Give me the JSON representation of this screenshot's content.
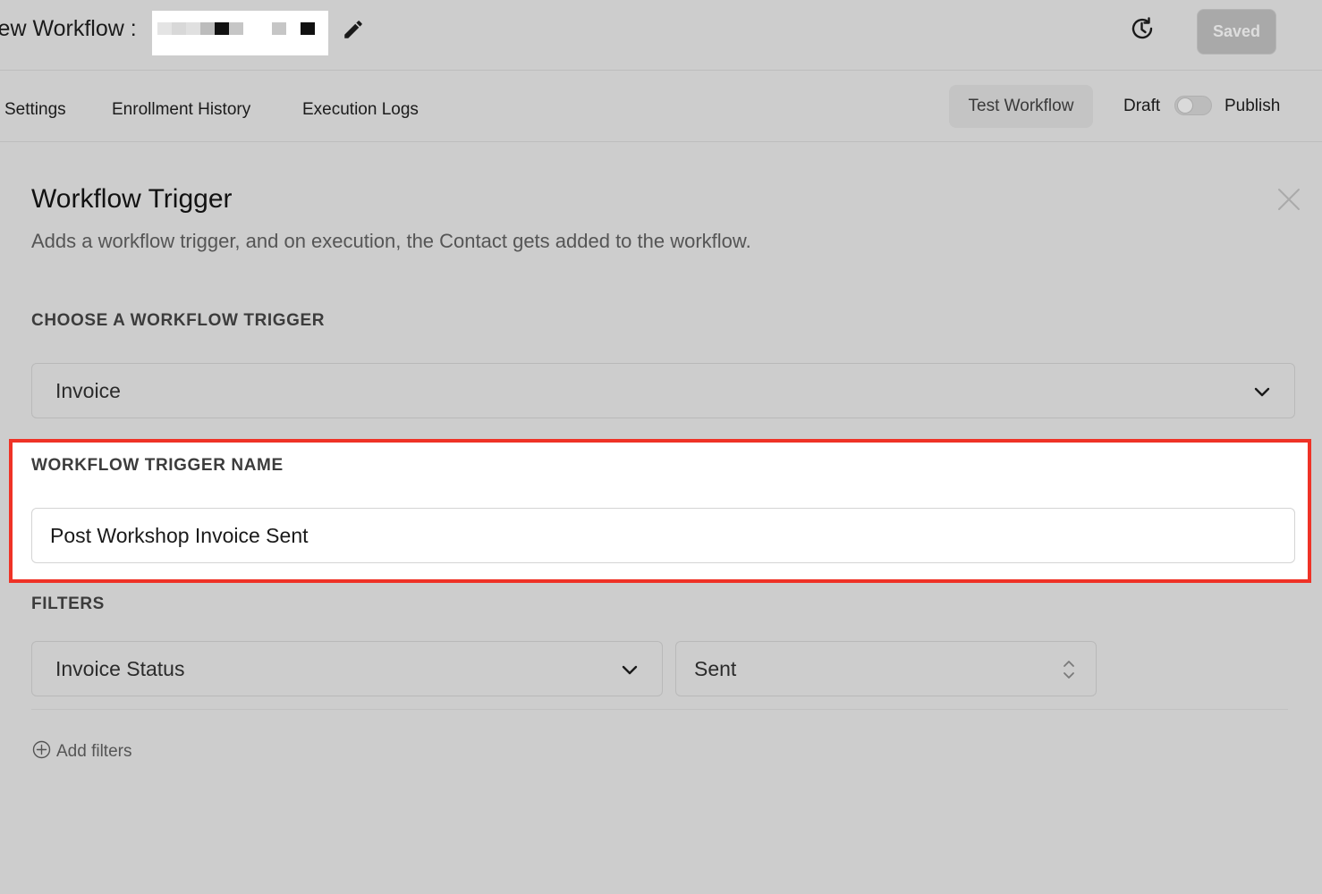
{
  "header": {
    "title": "lew Workflow :",
    "save_label": "Saved",
    "redaction_colors": [
      "#e4e4e4",
      "#d8d8d8",
      "#bcbcbc",
      "#111111",
      "#e8e8e8",
      "#c6c6c6",
      "#111111"
    ]
  },
  "tabs": [
    {
      "label": "Settings"
    },
    {
      "label": "Enrollment History"
    },
    {
      "label": "Execution Logs"
    }
  ],
  "toolbar": {
    "test_label": "Test Workflow",
    "draft_label": "Draft",
    "publish_label": "Publish",
    "publish_toggle_on": false
  },
  "panel": {
    "title": "Workflow Trigger",
    "subtitle": "Adds a workflow trigger, and on execution, the Contact gets added to the workflow.",
    "choose_label": "CHOOSE A WORKFLOW TRIGGER",
    "trigger_value": "Invoice",
    "name_label": "WORKFLOW TRIGGER NAME",
    "name_value": "Post Workshop Invoice Sent",
    "filters_label": "FILTERS",
    "filter_field": "Invoice Status",
    "filter_value": "Sent",
    "add_filters_label": "Add filters"
  },
  "colors": {
    "background": "#cdcdcd",
    "highlight_border": "#ef3226"
  },
  "icons": [
    "pencil-icon",
    "history-icon",
    "close-icon",
    "chevron-down-icon",
    "chevron-up-down-icon",
    "plus-circle-icon"
  ]
}
